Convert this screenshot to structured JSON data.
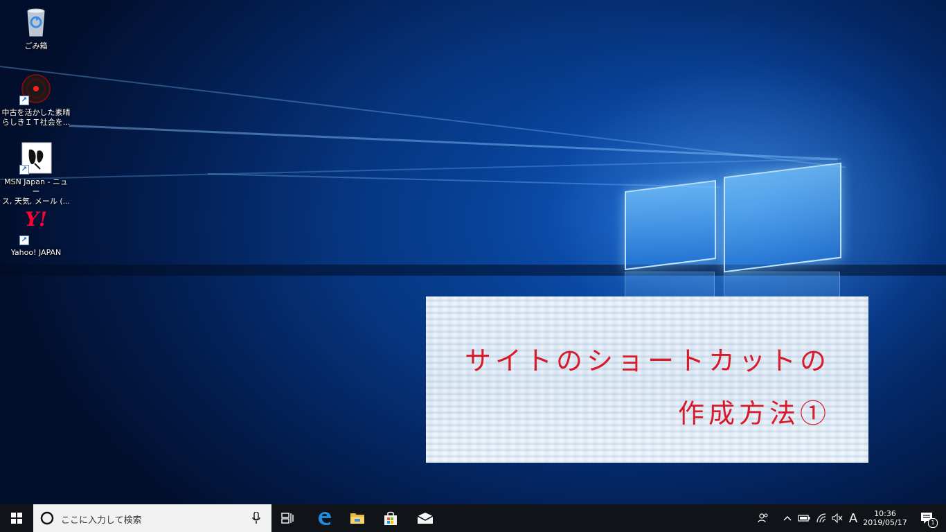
{
  "desktop": {
    "icons": [
      {
        "label_line1": "ごみ箱",
        "label_line2": "",
        "icon": "recycle-bin-icon"
      },
      {
        "label_line1": "中古を活かした素晴",
        "label_line2": "らしきＩＴ社会を...",
        "icon": "record-target-icon"
      },
      {
        "label_line1": "MSN Japan - ニュー",
        "label_line2": "ス, 天気, メール (...",
        "icon": "msn-butterfly-icon"
      },
      {
        "label_line1": "Yahoo! JAPAN",
        "label_line2": "",
        "icon": "yahoo-logo-icon"
      }
    ],
    "yahoo_logo_text": "Y!",
    "accent_color": "#0a4fb0"
  },
  "overlay": {
    "line1": "サイトのショートカットの",
    "line2": "作成方法①",
    "text_color": "#d81b2a"
  },
  "taskbar": {
    "search_placeholder": "ここに入力して検索",
    "pinned": [
      "task-view-icon",
      "edge-icon",
      "file-explorer-icon",
      "store-icon",
      "mail-icon"
    ],
    "tray": {
      "ime_indicator": "A",
      "time": "10:36",
      "date": "2019/05/17",
      "notification_count": "1"
    }
  }
}
